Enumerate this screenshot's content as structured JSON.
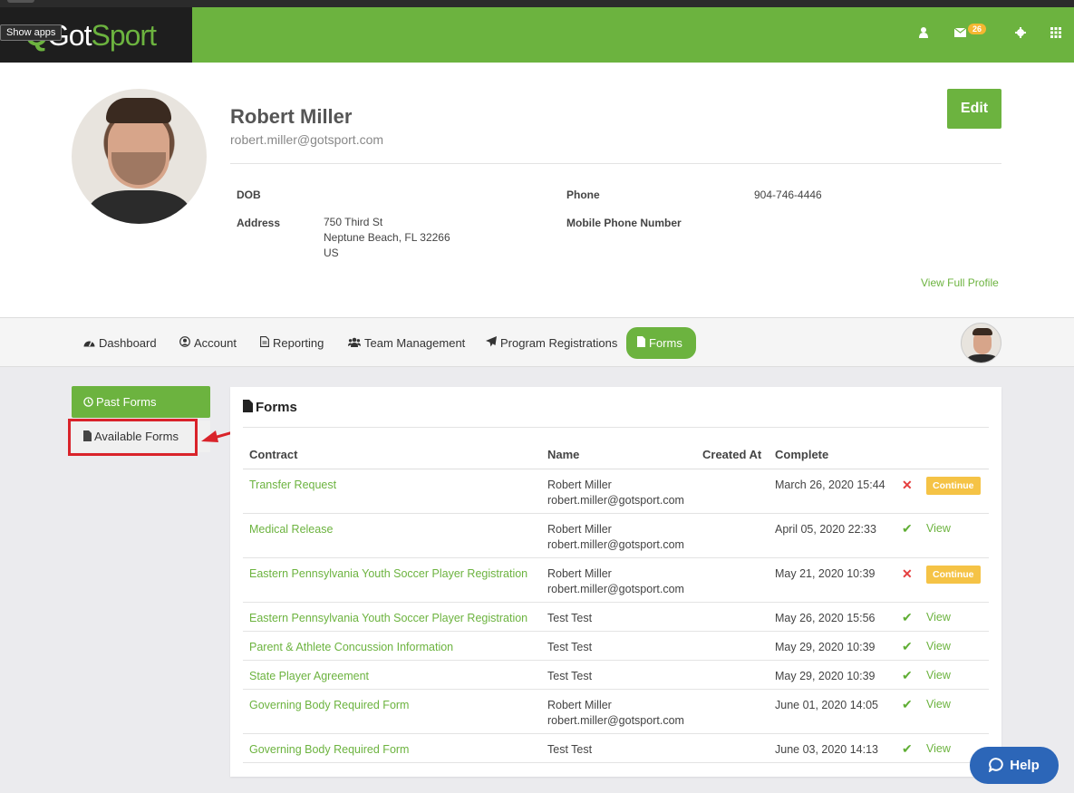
{
  "header": {
    "logo_prefix": "Q",
    "logo_got": "Got",
    "logo_sport": "Sport",
    "show_apps": "Show apps",
    "mail_count": "26"
  },
  "profile": {
    "name": "Robert Miller",
    "email": "robert.miller@gotsport.com",
    "edit_label": "Edit",
    "dob_label": "DOB",
    "dob_value": "",
    "address_label": "Address",
    "address_line1": "750 Third St",
    "address_line2": "Neptune Beach, FL 32266",
    "address_line3": "US",
    "phone_label": "Phone",
    "phone_value": "904-746-4446",
    "mobile_label": "Mobile Phone Number",
    "mobile_value": "",
    "view_full_profile": "View Full Profile"
  },
  "nav": {
    "items": [
      {
        "label": "Dashboard",
        "icon": "dashboard-icon"
      },
      {
        "label": "Account",
        "icon": "user-circle-icon"
      },
      {
        "label": "Reporting",
        "icon": "document-icon"
      },
      {
        "label": "Team Management",
        "icon": "users-icon"
      },
      {
        "label": "Program Registrations",
        "icon": "paper-plane-icon"
      },
      {
        "label": "Forms",
        "icon": "file-icon"
      }
    ],
    "active": "Forms"
  },
  "sidebar": {
    "past_forms": "Past Forms",
    "available_forms": "Available Forms"
  },
  "forms": {
    "title": "Forms",
    "columns": [
      "Contract",
      "Name",
      "Created At",
      "Complete"
    ],
    "rows": [
      {
        "contract": "Transfer Request",
        "name": "Robert Miller",
        "email": "robert.miller@gotsport.com",
        "created": "",
        "complete": "March 26, 2020 15:44",
        "status": "incomplete",
        "action": "Continue"
      },
      {
        "contract": "Medical Release",
        "name": "Robert Miller",
        "email": "robert.miller@gotsport.com",
        "created": "",
        "complete": "April 05, 2020 22:33",
        "status": "complete",
        "action": "View"
      },
      {
        "contract": "Eastern Pennsylvania Youth Soccer Player Registration",
        "name": "Robert Miller",
        "email": "robert.miller@gotsport.com",
        "created": "",
        "complete": "May 21, 2020 10:39",
        "status": "incomplete",
        "action": "Continue"
      },
      {
        "contract": "Eastern Pennsylvania Youth Soccer Player Registration",
        "name": "Test Test",
        "email": "",
        "created": "",
        "complete": "May 26, 2020 15:56",
        "status": "complete",
        "action": "View"
      },
      {
        "contract": "Parent & Athlete Concussion Information",
        "name": "Test Test",
        "email": "",
        "created": "",
        "complete": "May 29, 2020 10:39",
        "status": "complete",
        "action": "View"
      },
      {
        "contract": "State Player Agreement",
        "name": "Test Test",
        "email": "",
        "created": "",
        "complete": "May 29, 2020 10:39",
        "status": "complete",
        "action": "View"
      },
      {
        "contract": "Governing Body Required Form",
        "name": "Robert Miller",
        "email": "robert.miller@gotsport.com",
        "created": "",
        "complete": "June 01, 2020 14:05",
        "status": "complete",
        "action": "View"
      },
      {
        "contract": "Governing Body Required Form",
        "name": "Test Test",
        "email": "",
        "created": "",
        "complete": "June 03, 2020 14:13",
        "status": "complete",
        "action": "View"
      }
    ]
  },
  "help": {
    "label": "Help"
  },
  "colors": {
    "brand_green": "#6cb33f",
    "continue_yellow": "#f5c346",
    "error_red": "#e53e3e",
    "help_blue": "#2c66b8",
    "annotation_red": "#d9232a"
  }
}
